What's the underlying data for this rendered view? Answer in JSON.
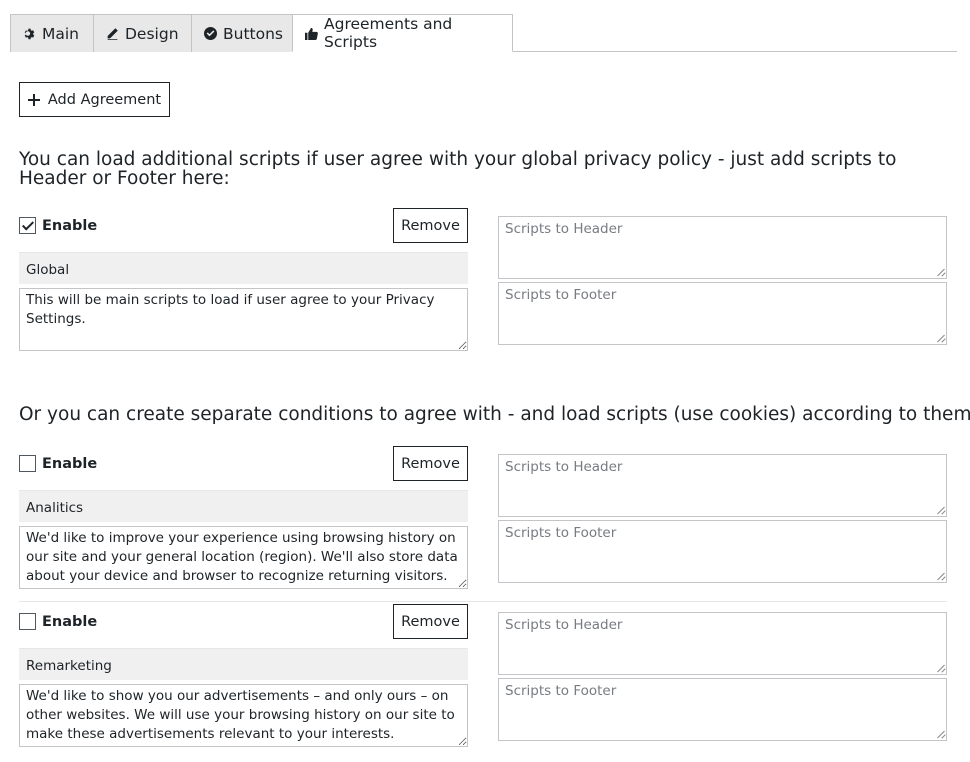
{
  "tabs": [
    {
      "label": "Main",
      "icon": "gear-icon"
    },
    {
      "label": "Design",
      "icon": "pencil-icon"
    },
    {
      "label": "Buttons",
      "icon": "check-circle-icon"
    },
    {
      "label": "Agreements and Scripts",
      "icon": "thumbs-up-icon",
      "active": true
    }
  ],
  "add_agreement_label": "Add Agreement",
  "heading_global": "You can load additional scripts if user agree with your global privacy policy - just add scripts to Header or Footer here:",
  "heading_separate": "Or you can create separate conditions to agree with - and load scripts (use cookies) according to them:",
  "agreements": [
    {
      "enable_label": "Enable",
      "checked": true,
      "remove_label": "Remove",
      "name": "Global",
      "description": "This will be main scripts to load if user agree to your Privacy Settings.",
      "header_placeholder": "Scripts to Header",
      "footer_placeholder": "Scripts to Footer"
    },
    {
      "enable_label": "Enable",
      "checked": false,
      "remove_label": "Remove",
      "name": "Analitics",
      "description": "We'd like to improve your experience using browsing history on our site and your general location (region). We'll also store data about your device and browser to recognize returning visitors.",
      "header_placeholder": "Scripts to Header",
      "footer_placeholder": "Scripts to Footer"
    },
    {
      "enable_label": "Enable",
      "checked": false,
      "remove_label": "Remove",
      "name": "Remarketing",
      "description": "We'd like to show you our advertisements – and only ours – on other websites. We will use your browsing history on our site to make these advertisements relevant to your interests.",
      "header_placeholder": "Scripts to Header",
      "footer_placeholder": "Scripts to Footer"
    }
  ]
}
